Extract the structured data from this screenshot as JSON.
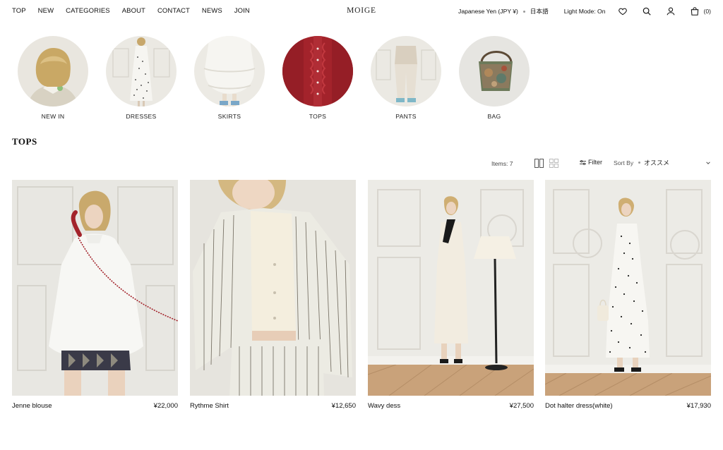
{
  "nav": {
    "items": [
      "TOP",
      "NEW",
      "CATEGORIES",
      "ABOUT",
      "CONTACT",
      "NEWS",
      "JOIN"
    ]
  },
  "brand": {
    "logo": "MOIGE"
  },
  "header": {
    "currency": "Japanese Yen (JPY ¥)",
    "language": "日本語",
    "mode": "Light Mode: On",
    "cart_count": "(0)"
  },
  "categories": [
    {
      "label": "NEW IN",
      "icon": "blonde-model-photo"
    },
    {
      "label": "DRESSES",
      "icon": "dress-photo"
    },
    {
      "label": "SKIRTS",
      "icon": "skirt-photo"
    },
    {
      "label": "TOPS",
      "icon": "red-top-photo"
    },
    {
      "label": "PANTS",
      "icon": "pants-photo"
    },
    {
      "label": "BAG",
      "icon": "bag-photo"
    }
  ],
  "section": {
    "title": "TOPS"
  },
  "toolbar": {
    "items_count": "Items: 7",
    "filter_label": "Filter",
    "sort_label": "Sort By",
    "sort_value": "オススメ"
  },
  "products": [
    {
      "name": "Jenne blouse",
      "price": "¥22,000"
    },
    {
      "name": "Rythme Shirt",
      "price": "¥12,650"
    },
    {
      "name": "Wavy dess",
      "price": "¥27,500"
    },
    {
      "name": "Dot halter dress(white)",
      "price": "¥17,930"
    }
  ],
  "colors": {
    "text": "#111111",
    "background": "#ffffff",
    "accent_red": "#a3232b",
    "wall_white": "#ecebe6",
    "parquet": "#c9a27a"
  }
}
